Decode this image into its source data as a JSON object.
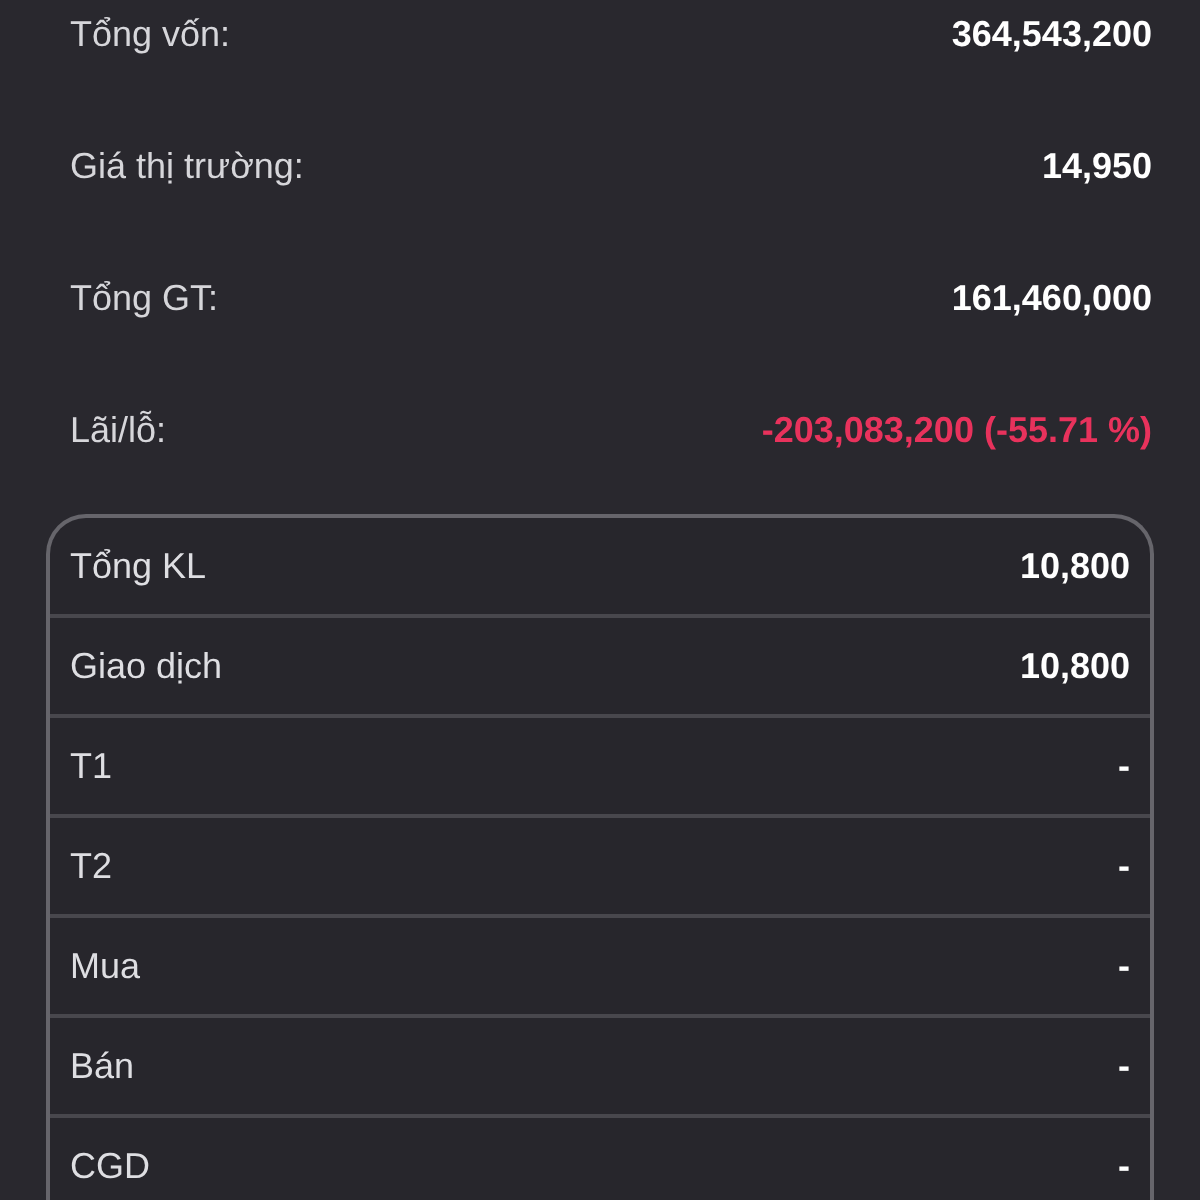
{
  "summary": [
    {
      "label": "Tổng vốn:",
      "value": "364,543,200",
      "kind": "plain"
    },
    {
      "label": "Giá thị trường:",
      "value": "14,950",
      "kind": "plain"
    },
    {
      "label": "Tổng GT:",
      "value": "161,460,000",
      "kind": "plain"
    },
    {
      "label": "Lãi/lỗ:",
      "value": "-203,083,200 (-55.71 %)",
      "kind": "loss"
    }
  ],
  "details": [
    {
      "label": "Tổng KL",
      "value": "10,800"
    },
    {
      "label": "Giao dịch",
      "value": "10,800"
    },
    {
      "label": "T1",
      "value": "-"
    },
    {
      "label": "T2",
      "value": "-"
    },
    {
      "label": "Mua",
      "value": "-"
    },
    {
      "label": "Bán",
      "value": "-"
    },
    {
      "label": "CGD",
      "value": "-"
    }
  ]
}
